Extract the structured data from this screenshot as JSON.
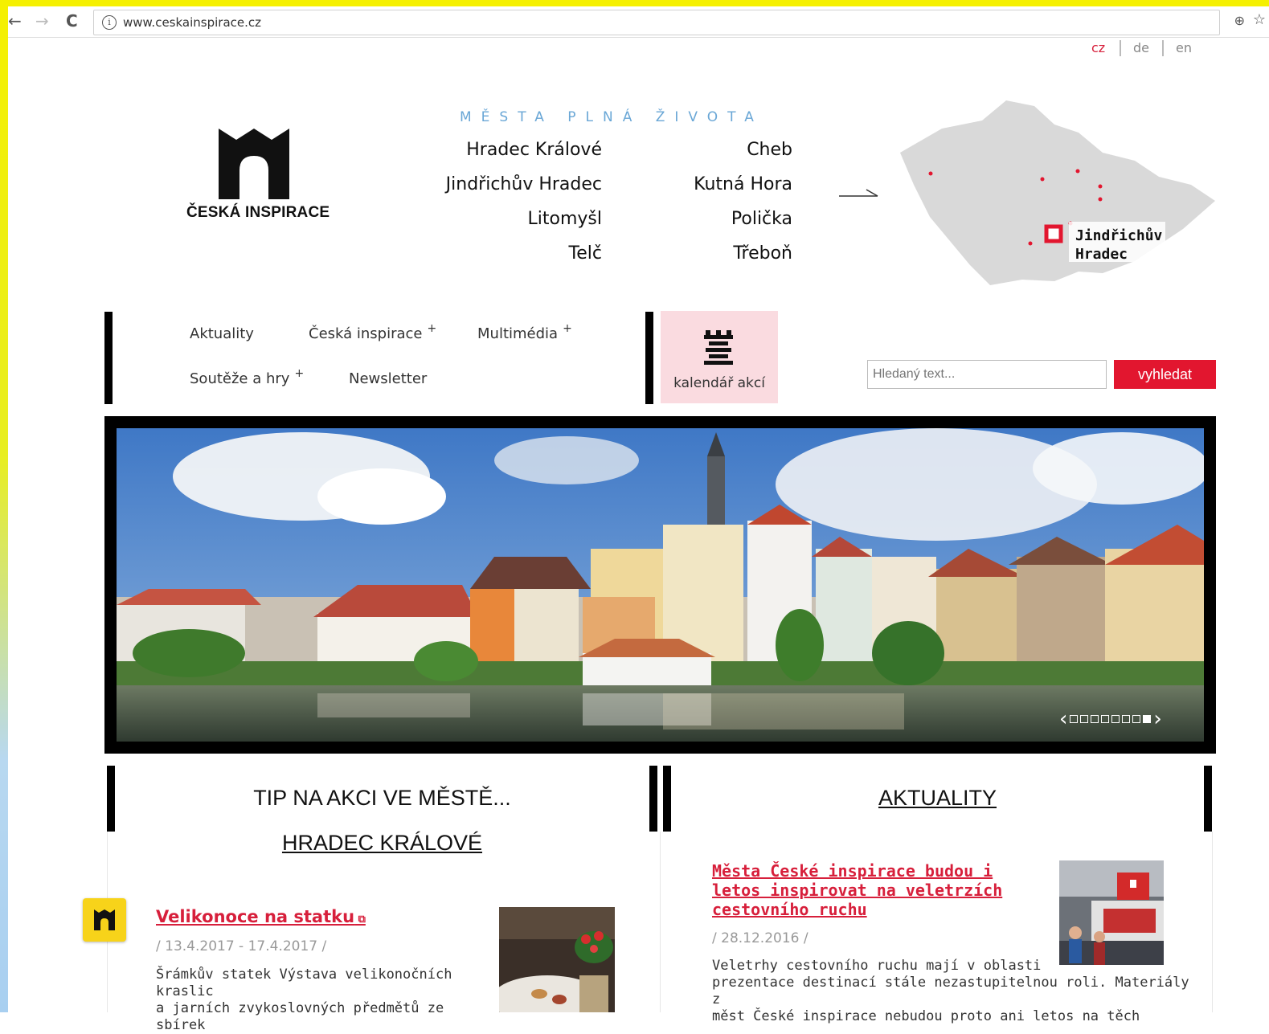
{
  "browser": {
    "url": "www.ceskainspirace.cz",
    "back": "←",
    "forward": "→",
    "reload": "C",
    "info": "i"
  },
  "languages": [
    "cz",
    "de",
    "en"
  ],
  "logo": {
    "name": "ČESKÁ INSPIRACE"
  },
  "tagline": "MĚSTA PLNÁ ŽIVOTA",
  "cities_left": [
    "Hradec Králové",
    "Jindřichův Hradec",
    "Litomyšl",
    "Telč"
  ],
  "cities_right": [
    "Cheb",
    "Kutná Hora",
    "Polička",
    "Třeboň"
  ],
  "map": {
    "highlight_line1": "Jindřichův",
    "highlight_line2": "Hradec"
  },
  "menu": {
    "aktuality": "Aktuality",
    "ceska_inspirace": "Česká inspirace",
    "multimedia": "Multimédia",
    "souteze": "Soutěže a hry",
    "newsletter": "Newsletter",
    "plus": "+"
  },
  "calendar": {
    "label": "kalendář akcí"
  },
  "search": {
    "placeholder": "Hledaný text...",
    "button": "vyhledat"
  },
  "slider": {
    "prev": "‹",
    "next": "›",
    "total": 8,
    "active_index": 7
  },
  "tip": {
    "heading": "TIP NA AKCI VE MĚSTĚ...",
    "city": "HRADEC KRÁLOVÉ",
    "event_title": "Velikonoce na statku",
    "event_date": "/ 13.4.2017 - 17.4.2017 /",
    "event_text_1": "Šrámkův statek Výstava velikonočních kraslic",
    "event_text_2": "a jarních zvykoslovných předmětů ze sbírek"
  },
  "news": {
    "heading": "AKTUALITY",
    "title": "Města České inspirace budou i letos inspirovat na veletrzích cestovního ruchu",
    "date": "/ 28.12.2016 /",
    "text_1": "Veletrhy cestovního ruchu mají v oblasti",
    "text_2": "prezentace destinací stále nezastupitelnou roli. Materiály z",
    "text_3": "měst České inspirace nebudou proto ani letos na těch"
  },
  "colors": {
    "accent": "#e2162f",
    "tagline": "#6aa7d6",
    "calendar_bg": "#fadbe0"
  }
}
